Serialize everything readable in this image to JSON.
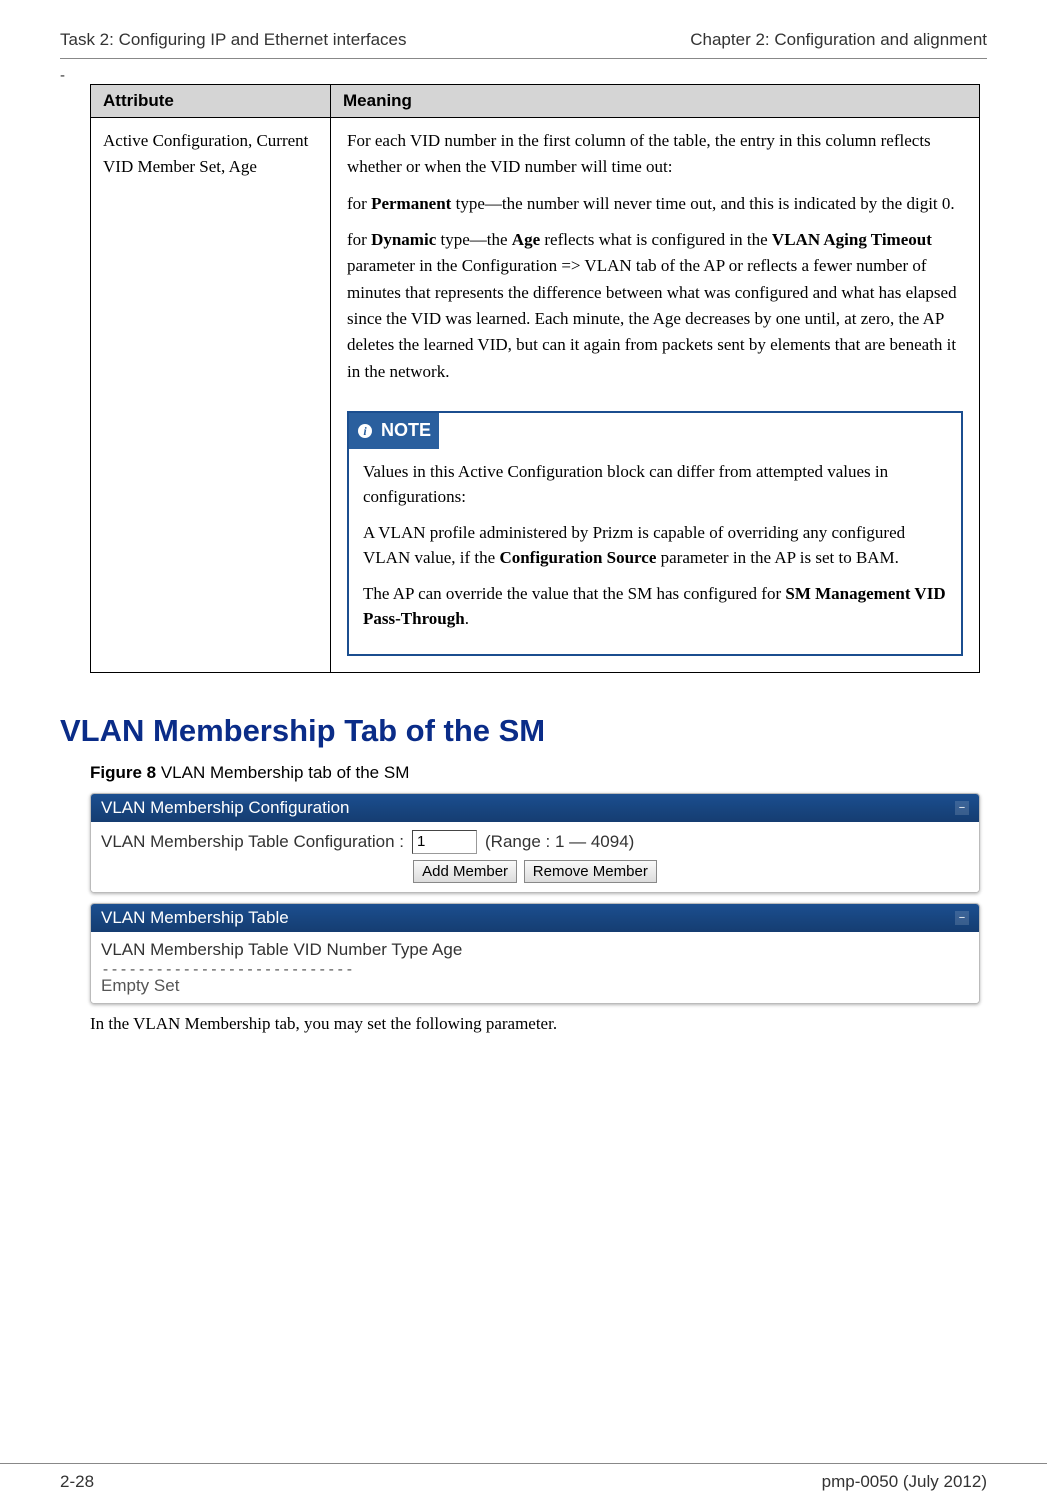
{
  "header": {
    "left": "Task 2: Configuring IP and Ethernet interfaces",
    "right": "Chapter 2:  Configuration and alignment"
  },
  "dash": "-",
  "table": {
    "col1": "Attribute",
    "col2": "Meaning",
    "attr": "Active Configuration, Current VID Member Set, Age",
    "p1": "For each VID number in the first column of the table, the entry in this column reflects whether or when the VID number will time out:",
    "p2_pre": "for ",
    "p2_b": "Permanent",
    "p2_post": " type—the number will never time out, and this is indicated by the digit 0.",
    "p3_pre": "for ",
    "p3_b1": "Dynamic",
    "p3_mid1": " type—the ",
    "p3_b2": "Age",
    "p3_mid2": " reflects what is configured in the ",
    "p3_b3": "VLAN Aging Timeout",
    "p3_post": " parameter in the Configuration => VLAN tab of the AP or reflects a fewer number of minutes that represents the difference between what was configured and what has elapsed since the VID was learned. Each minute, the Age decreases by one until, at zero, the AP deletes the learned VID, but can it again from packets sent by elements that are beneath it in the network."
  },
  "note": {
    "label": "NOTE",
    "p1": "Values in this Active Configuration block can differ from attempted values in configurations:",
    "p2_pre": "A VLAN profile administered by Prizm is capable of overriding any configured VLAN value, if the ",
    "p2_b": "Configuration Source",
    "p2_post": " parameter in the AP is set to BAM.",
    "p3_pre": "The AP can override the value that the SM has configured for ",
    "p3_b": "SM Management VID Pass-Through",
    "p3_post": "."
  },
  "section_title": "VLAN Membership Tab of the SM",
  "figure": {
    "label_b": "Figure 8",
    "label_rest": " VLAN Membership tab of the SM"
  },
  "panel1": {
    "title": "VLAN Membership Configuration",
    "row_label": "VLAN Membership Table Configuration :",
    "input_value": "1",
    "range_text": "(Range : 1 — 4094)",
    "btn_add": "Add Member",
    "btn_remove": "Remove Member"
  },
  "panel2": {
    "title": "VLAN Membership Table",
    "cols": "VLAN Membership Table VID Number   Type   Age",
    "dashes": "----------------------------",
    "empty": "Empty Set"
  },
  "after_figure": "In the VLAN Membership tab, you may set the following parameter.",
  "footer": {
    "left": "2-28",
    "right": "pmp-0050 (July 2012)"
  }
}
